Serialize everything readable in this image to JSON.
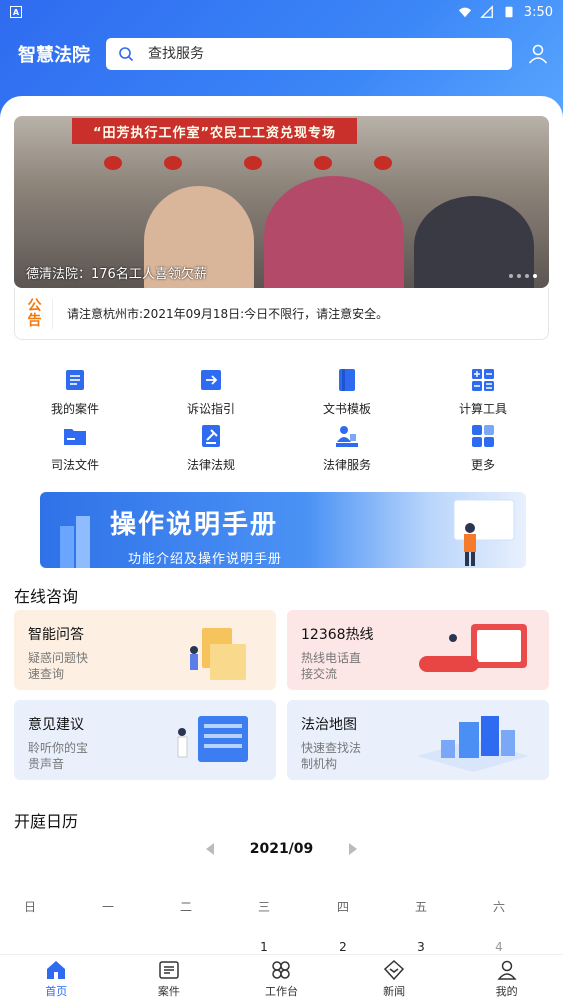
{
  "status_bar": {
    "time": "3:50"
  },
  "header": {
    "title": "智慧法院",
    "search_placeholder": "查找服务"
  },
  "banner": {
    "caption": "德清法院：176名工人喜领欠薪",
    "sign_text": "“田芳执行工作室”农民工工资兑现专场"
  },
  "notice": {
    "tag": "公告",
    "text": "请注意杭州市:2021年09月18日:今日不限行，请注意安全。"
  },
  "quick_menu": [
    {
      "label": "我的案件",
      "icon": "case-list-icon"
    },
    {
      "label": "诉讼指引",
      "icon": "guide-icon"
    },
    {
      "label": "文书模板",
      "icon": "document-template-icon"
    },
    {
      "label": "计算工具",
      "icon": "calculator-icon"
    },
    {
      "label": "司法文件",
      "icon": "folder-icon"
    },
    {
      "label": "法律法规",
      "icon": "law-book-icon"
    },
    {
      "label": "法律服务",
      "icon": "legal-service-icon"
    },
    {
      "label": "更多",
      "icon": "more-grid-icon"
    }
  ],
  "manual_banner": {
    "title": "操作说明手册",
    "subtitle": "功能介绍及操作说明手册"
  },
  "online_consult": {
    "title": "在线咨询",
    "cards": [
      {
        "title": "智能问答",
        "desc": "疑惑问题快速查询",
        "color": "#fdf0e2"
      },
      {
        "title": "12368热线",
        "desc": "热线电话直接交流",
        "color": "#fde6e6"
      },
      {
        "title": "意见建议",
        "desc": "聆听你的宝贵声音",
        "color": "#e9f0fc"
      },
      {
        "title": "法治地图",
        "desc": "快速查找法制机构",
        "color": "#e9f0fc"
      }
    ]
  },
  "court_calendar": {
    "title": "开庭日历",
    "month": "2021/09",
    "weekdays": [
      "日",
      "一",
      "二",
      "三",
      "四",
      "五",
      "六"
    ],
    "visible_days": [
      "1",
      "2",
      "3",
      "4"
    ]
  },
  "tabbar": [
    {
      "label": "首页",
      "icon": "home-icon",
      "active": true
    },
    {
      "label": "案件",
      "icon": "case-icon",
      "active": false
    },
    {
      "label": "工作台",
      "icon": "workbench-icon",
      "active": false
    },
    {
      "label": "新闻",
      "icon": "news-icon",
      "active": false
    },
    {
      "label": "我的",
      "icon": "profile-icon",
      "active": false
    }
  ],
  "colors": {
    "primary": "#2f6bf0",
    "notice_tag": "#f07a12"
  }
}
